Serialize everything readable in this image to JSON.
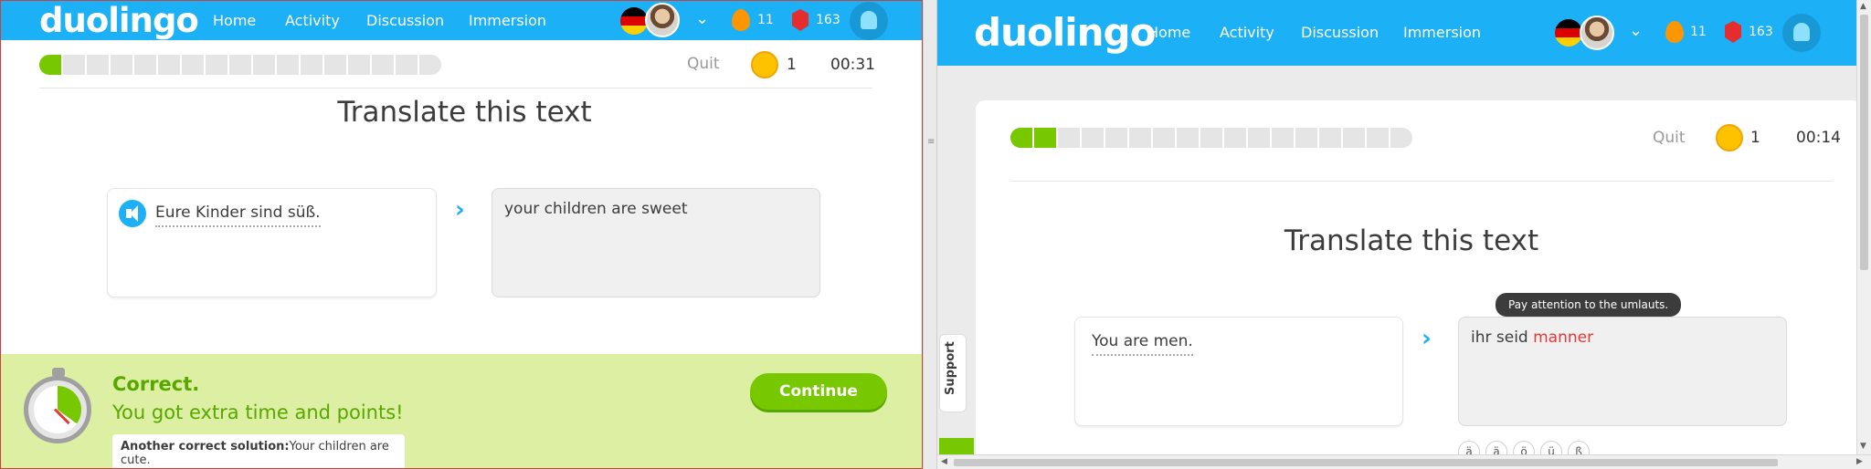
{
  "left": {
    "logo": "duolingo",
    "nav": [
      "Home",
      "Activity",
      "Discussion",
      "Immersion"
    ],
    "streak": "11",
    "gems": "163",
    "progress": {
      "filled": 1,
      "total": 17
    },
    "quit": "Quit",
    "coins": "1",
    "timer": "00:31",
    "title": "Translate this text",
    "prompt": "Eure Kinder sind süß.",
    "answer": "your children are sweet",
    "footer": {
      "title": "Correct.",
      "subtitle": "You got extra time and points!",
      "solution_label": "Another correct solution:",
      "solution_text": "Your children are cute.",
      "continue": "Continue"
    }
  },
  "right": {
    "logo": "duolingo",
    "nav": [
      "Home",
      "Activity",
      "Discussion",
      "Immersion"
    ],
    "streak": "11",
    "gems": "163",
    "progress": {
      "filled": 2,
      "total": 17
    },
    "quit": "Quit",
    "coins": "1",
    "timer": "00:14",
    "title": "Translate this text",
    "prompt": "You are men.",
    "answer_prefix": "ihr seid ",
    "answer_wrong": "manner",
    "tooltip": "Pay attention to the umlauts.",
    "support": "Support",
    "special_chars": [
      "ä",
      "ä",
      "ö",
      "ü",
      "ß"
    ]
  },
  "colors": {
    "brand": "#1cb0f6",
    "success": "#78c800",
    "error": "#e53838"
  }
}
